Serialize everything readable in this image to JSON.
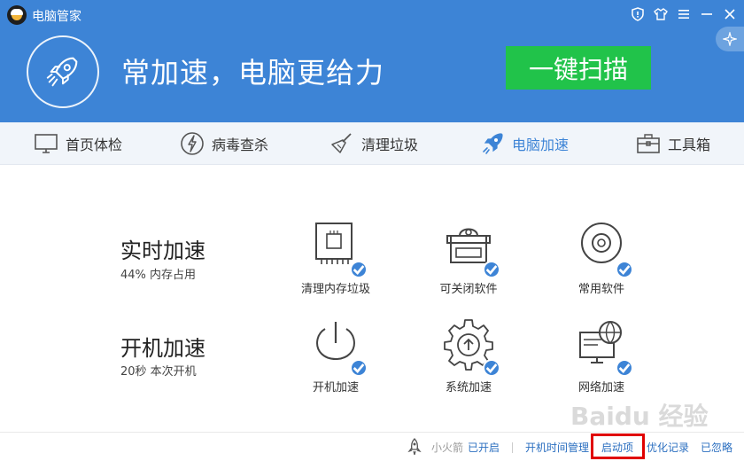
{
  "window": {
    "title": "电脑管家"
  },
  "header": {
    "slogan": "常加速，电脑更给力",
    "scan_button": "一键扫描"
  },
  "nav": {
    "items": [
      {
        "label": "首页体检",
        "icon": "monitor-icon"
      },
      {
        "label": "病毒查杀",
        "icon": "lightning-icon"
      },
      {
        "label": "清理垃圾",
        "icon": "broom-icon"
      },
      {
        "label": "电脑加速",
        "icon": "rocket-icon",
        "active": true
      },
      {
        "label": "工具箱",
        "icon": "toolbox-icon"
      }
    ]
  },
  "realtime": {
    "title": "实时加速",
    "subtitle": "44% 内存占用",
    "features": [
      {
        "label": "清理内存垃圾",
        "icon": "memory-chip-icon"
      },
      {
        "label": "可关闭软件",
        "icon": "software-box-icon"
      },
      {
        "label": "常用软件",
        "icon": "disc-icon"
      }
    ]
  },
  "boot": {
    "title": "开机加速",
    "subtitle": "20秒 本次开机",
    "features": [
      {
        "label": "开机加速",
        "icon": "power-icon"
      },
      {
        "label": "系统加速",
        "icon": "gear-icon"
      },
      {
        "label": "网络加速",
        "icon": "globe-monitor-icon"
      }
    ]
  },
  "footer": {
    "rocket_label": "小火箭",
    "rocket_status": "已开启",
    "links": [
      "开机时间管理",
      "启动项",
      "优化记录",
      "已忽略"
    ]
  },
  "watermark": "Baidu 经验",
  "colors": {
    "primary": "#3d84d6",
    "scan_green": "#21c34a",
    "highlight": "#e00000"
  }
}
